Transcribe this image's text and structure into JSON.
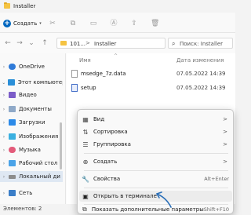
{
  "window": {
    "title": "Installer"
  },
  "toolbar": {
    "new_label": "Создать"
  },
  "address": {
    "crumbs": [
      "101...",
      "Installer"
    ],
    "separator": ">",
    "search_placeholder": "Поиск: Installer"
  },
  "sidebar": {
    "items": [
      {
        "label": "OneDrive",
        "color": "#2f7ad8"
      },
      {
        "label": "Этот компьютер",
        "color": "#2a8fd8"
      },
      {
        "label": "Видео",
        "color": "#7b5cc8"
      },
      {
        "label": "Документы",
        "color": "#8fa9c8"
      },
      {
        "label": "Загрузки",
        "color": "#2c8ae8"
      },
      {
        "label": "Изображения",
        "color": "#3bb0e0"
      },
      {
        "label": "Музыка",
        "color": "#e35b7a"
      },
      {
        "label": "Рабочий стол",
        "color": "#4aa3e8"
      },
      {
        "label": "Локальный ди",
        "color": "#8c8c8c"
      },
      {
        "label": "Сеть",
        "color": "#3a7ec8"
      }
    ]
  },
  "files": {
    "columns": {
      "name": "Имя",
      "date": "Дата изменения"
    },
    "rows": [
      {
        "name": "msedge_7z.data",
        "date": "07.05.2022 14:39"
      },
      {
        "name": "setup",
        "date": "07.05.2022 14:39"
      }
    ]
  },
  "status": {
    "text": "Элементов: 2"
  },
  "context_menu": {
    "items": [
      {
        "label": "Вид",
        "icon": "grid-icon",
        "arrow": ">"
      },
      {
        "label": "Сортировка",
        "icon": "sort-icon",
        "arrow": ">"
      },
      {
        "label": "Группировка",
        "icon": "group-icon",
        "arrow": ">"
      },
      {
        "label": "Создать",
        "icon": "new-icon",
        "arrow": ">"
      },
      {
        "label": "Свойства",
        "icon": "properties-icon",
        "shortcut": "Alt+Enter"
      },
      {
        "label": "Открыть в терминале",
        "icon": "terminal-icon"
      },
      {
        "label": "Показать дополнительные параметры",
        "icon": "more-options-icon",
        "shortcut": "Shift+F10"
      }
    ]
  },
  "colors": {
    "accent": "#0067c0",
    "annotation": "#2b6fb8"
  }
}
